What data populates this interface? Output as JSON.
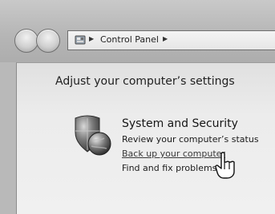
{
  "address_bar": {
    "location": "Control Panel"
  },
  "page": {
    "title": "Adjust your computer’s settings"
  },
  "category": {
    "title": "System and Security",
    "icon": "shield-globe-icon",
    "tasks": [
      "Review your computer’s status",
      "Back up your computer",
      "Find and fix problems"
    ]
  },
  "cursor": {
    "icon": "hand-pointer-icon"
  }
}
